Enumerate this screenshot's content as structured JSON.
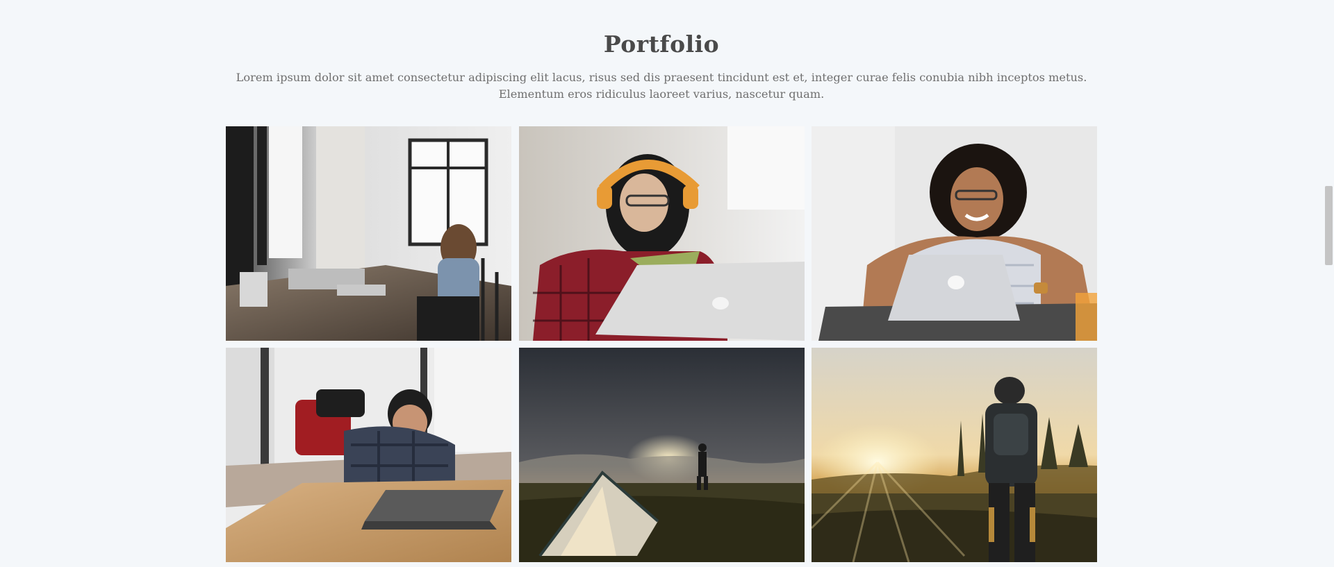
{
  "portfolio": {
    "title": "Portfolio",
    "description": "Lorem ipsum dolor sit amet consectetur adipiscing elit lacus, risus sed dis praesent tincidunt est et, integer curae felis conubia nibh inceptos metus. Elementum eros ridiculus laoreet varius, nascetur quam.",
    "items": [
      {
        "icon": "photo-woman-working-by-window-icon"
      },
      {
        "icon": "photo-woman-with-headphones-icon"
      },
      {
        "icon": "photo-smiling-woman-laptop-icon"
      },
      {
        "icon": "photo-man-thinking-laptop-icon"
      },
      {
        "icon": "photo-tent-sunset-icon"
      },
      {
        "icon": "photo-hiker-sunrise-icon"
      }
    ]
  },
  "scrollbar": {
    "position": 0.33
  }
}
